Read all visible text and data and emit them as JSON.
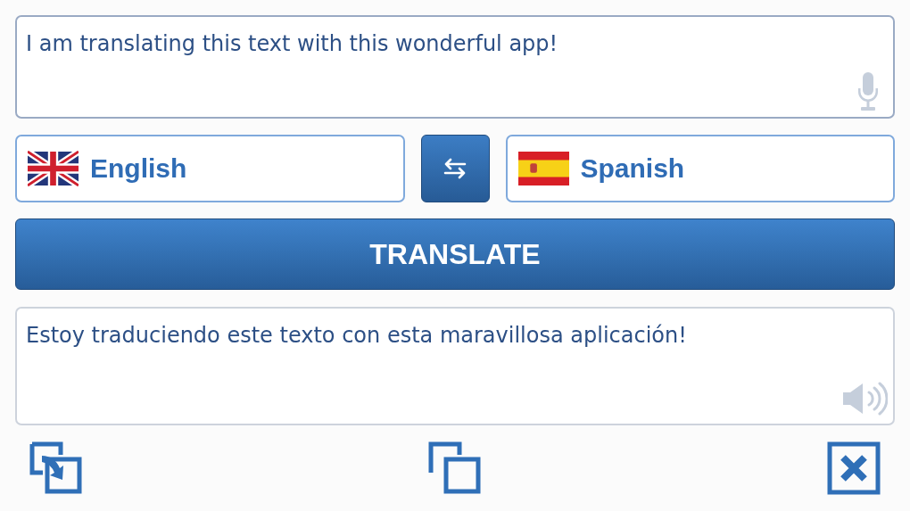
{
  "source_text": "I am translating this text with this wonderful app!",
  "source_language": "English",
  "target_language": "Spanish",
  "translate_button": "TRANSLATE",
  "result_text": "Estoy traduciendo este texto con esta maravillosa aplicación!"
}
